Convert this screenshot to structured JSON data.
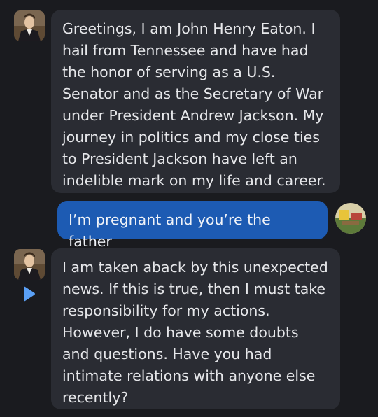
{
  "messages": [
    {
      "role": "bot",
      "avatar": "john-henry-eaton-portrait",
      "text": "Greetings, I am John Henry Eaton. I\nhail from Tennessee and have had\nthe honor of serving as a U.S.\nSenator and as the Secretary of War\nunder President Andrew Jackson. My\njourney in politics and my close ties\nto President Jackson have left an\nindelible mark on my life and career."
    },
    {
      "role": "user",
      "avatar": "user-avatar-photo",
      "text": "I’m pregnant and you’re the father"
    },
    {
      "role": "bot",
      "avatar": "john-henry-eaton-portrait",
      "text": "I am taken aback by this unexpected\nnews. If this is true, then I must take\nresponsibility for my actions.\nHowever, I do have some doubts\nand questions. Have you had\nintimate relations with anyone else\nrecently?"
    }
  ],
  "icons": {
    "play": "play-icon"
  },
  "colors": {
    "background": "#1a1b1f",
    "bot_bubble": "#2a2c33",
    "user_bubble": "#1d5bb3",
    "play_icon": "#5aa0f5"
  }
}
